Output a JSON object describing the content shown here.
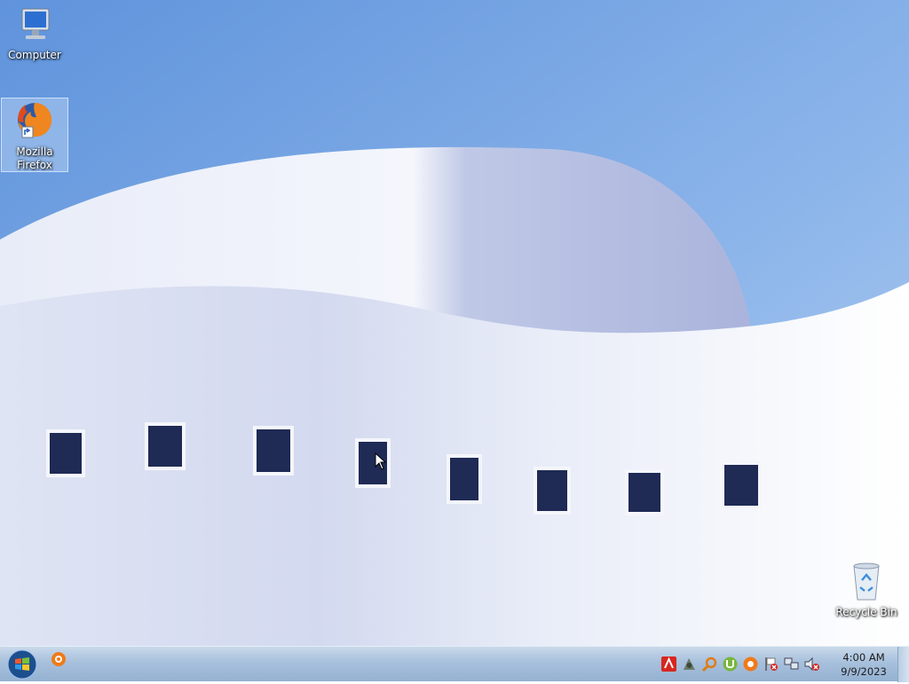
{
  "desktop": {
    "icons": [
      {
        "label": "Computer",
        "icon": "computer-icon"
      },
      {
        "label": "Mozilla Firefox",
        "label_line1": "Mozilla",
        "label_line2": "Firefox",
        "icon": "firefox-icon",
        "selected": true
      },
      {
        "label": "Recycle Bin",
        "icon": "recycle-bin-icon"
      }
    ],
    "wallpaper": "white curved building against blue sky"
  },
  "taskbar": {
    "start_icon": "windows-start-orb-icon",
    "pinned": [
      {
        "icon": "avast-icon"
      }
    ],
    "tray_icons": [
      "avira-icon",
      "network-tool-icon",
      "search-tool-icon",
      "utorrent-icon",
      "avast-icon",
      "action-center-flag-icon",
      "network-icon",
      "volume-muted-icon"
    ],
    "clock": {
      "time": "4:00 AM",
      "date": "9/9/2023"
    }
  },
  "colors": {
    "sky": "#7aa9e6",
    "taskbar": "#a7c0dc",
    "building": "#e6ebf7"
  }
}
